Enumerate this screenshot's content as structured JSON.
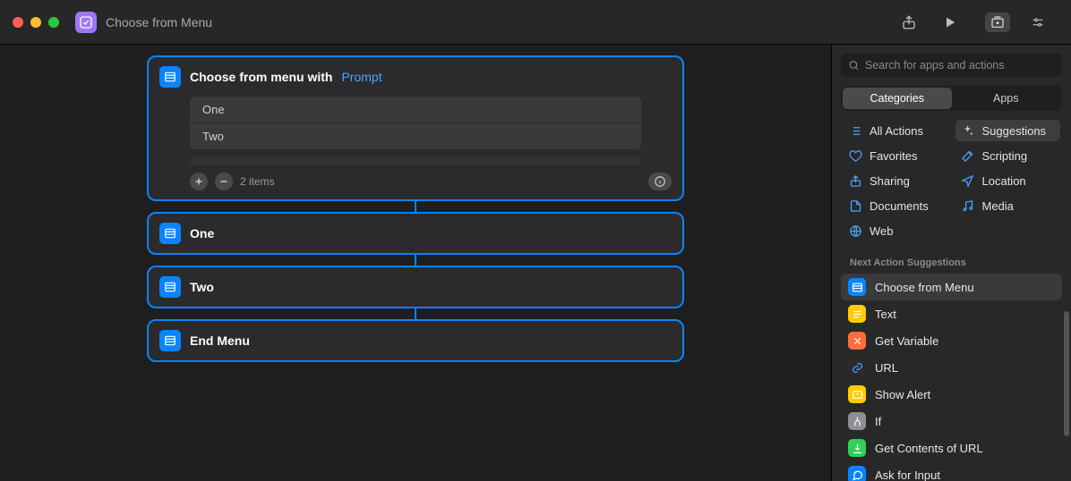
{
  "header": {
    "title": "Choose from Menu"
  },
  "action": {
    "title_prefix": "Choose from menu with",
    "prompt_token": "Prompt",
    "items": [
      "One",
      "Two"
    ],
    "count_label": "2 items"
  },
  "branches": {
    "one": "One",
    "two": "Two",
    "end": "End Menu"
  },
  "search": {
    "placeholder": "Search for apps and actions"
  },
  "segmented": {
    "categories": "Categories",
    "apps": "Apps"
  },
  "categories": {
    "all": "All Actions",
    "suggestions": "Suggestions",
    "favorites": "Favorites",
    "scripting": "Scripting",
    "sharing": "Sharing",
    "location": "Location",
    "documents": "Documents",
    "media": "Media",
    "web": "Web"
  },
  "suggestions": {
    "heading": "Next Action Suggestions",
    "items": [
      {
        "label": "Choose from Menu",
        "color": "#0a84ff",
        "glyph": "menu",
        "selected": true
      },
      {
        "label": "Text",
        "color": "#ffcc00",
        "glyph": "text",
        "selected": false
      },
      {
        "label": "Get Variable",
        "color": "#ff6d3b",
        "glyph": "var",
        "selected": false
      },
      {
        "label": "URL",
        "color": "#2a2a2c",
        "glyph": "link",
        "selected": false
      },
      {
        "label": "Show Alert",
        "color": "#ffcc00",
        "glyph": "alert",
        "selected": false
      },
      {
        "label": "If",
        "color": "#8e8e93",
        "glyph": "branch",
        "selected": false
      },
      {
        "label": "Get Contents of URL",
        "color": "#30d158",
        "glyph": "download",
        "selected": false
      },
      {
        "label": "Ask for Input",
        "color": "#0a84ff",
        "glyph": "chat",
        "selected": false
      }
    ]
  }
}
